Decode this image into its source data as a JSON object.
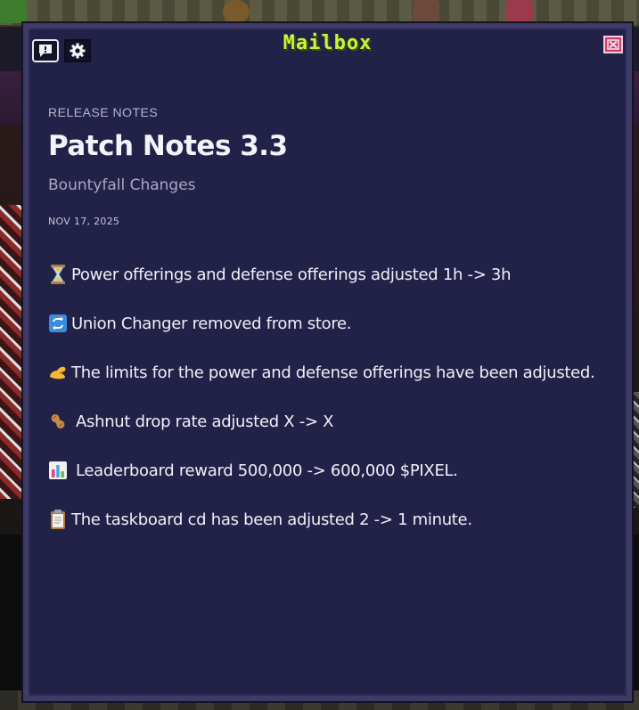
{
  "window": {
    "title": "Mailbox"
  },
  "toolbar": {
    "announcement_icon": "exclamation-bubble-icon",
    "settings_icon": "gear-icon",
    "close_icon": "close-icon"
  },
  "post": {
    "kicker": "RELEASE NOTES",
    "title": "Patch Notes 3.3",
    "subtitle": "Bountyfall Changes",
    "date": "NOV 17, 2025"
  },
  "notes": [
    {
      "icon": "hourglass-icon",
      "text": "Power offerings and defense offerings adjusted 1h -> 3h"
    },
    {
      "icon": "repeat-arrows-icon",
      "text": "Union Changer removed from store."
    },
    {
      "icon": "flexed-arm-icon",
      "text": "The limits for the power and defense offerings have been adjusted."
    },
    {
      "icon": "peanut-icon",
      "text": "Ashnut drop rate adjusted X -> X"
    },
    {
      "icon": "bar-chart-icon",
      "text": "Leaderboard reward 500,000 -> 600,000 $PIXEL."
    },
    {
      "icon": "clipboard-icon",
      "text": "The taskboard cd has been adjusted 2 -> 1 minute."
    }
  ],
  "colors": {
    "title_accent": "#c8f53a",
    "panel_bg": "#222148",
    "close_button": "#d23a6b"
  }
}
